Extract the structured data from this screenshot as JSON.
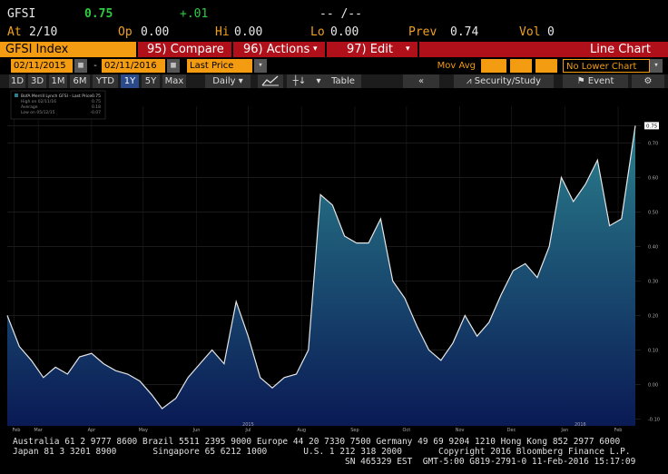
{
  "header": {
    "ticker": "GFSI",
    "last": "0.75",
    "change": "+.01",
    "range_placeholder": "-- /--",
    "at_label": "At",
    "at_value": "2/10",
    "op_label": "Op",
    "op_value": "0.00",
    "hi_label": "Hi",
    "hi_value": "0.00",
    "lo_label": "Lo",
    "lo_value": "0.00",
    "prev_label": "Prev",
    "prev_value": "0.74",
    "vol_label": "Vol",
    "vol_value": "0"
  },
  "command_bar": {
    "security": "GFSI Index",
    "compare": "95) Compare",
    "actions": "96) Actions",
    "edit": "97) Edit",
    "chart_type": "Line Chart"
  },
  "controls": {
    "start_date": "02/11/2015",
    "end_date": "02/11/2016",
    "dash": "-",
    "field": "Last Price",
    "mov_avg_label": "Mov Avg",
    "lower_chart": "No Lower Chart"
  },
  "periods": [
    "1D",
    "3D",
    "1M",
    "6M",
    "YTD",
    "1Y",
    "5Y",
    "Max"
  ],
  "selected_period": "1Y",
  "toolbar": {
    "frequency": "Daily",
    "table": "Table",
    "security_study": "Security/Study",
    "event": "Event"
  },
  "legend": {
    "title": "BofA Merrill Lynch GFSI - Last Price",
    "title_value": "0.75",
    "high_label": "High on 02/11/16",
    "high_value": "0.75",
    "avg_label": "Average",
    "avg_value": "0.18",
    "low_label": "Low on 05/12/15",
    "low_value": "-0.07"
  },
  "colors": {
    "accent_orange": "#f0a020",
    "command_red": "#b0101a",
    "last_green": "#2ecc40",
    "area_top": "#2a7f8c",
    "area_bottom": "#0a1a55"
  },
  "chart_data": {
    "type": "area",
    "x": [
      "2015-02-11",
      "2015-02-18",
      "2015-02-25",
      "2015-03-04",
      "2015-03-11",
      "2015-03-18",
      "2015-03-25",
      "2015-04-01",
      "2015-04-08",
      "2015-04-15",
      "2015-04-22",
      "2015-04-29",
      "2015-05-06",
      "2015-05-12",
      "2015-05-20",
      "2015-05-27",
      "2015-06-03",
      "2015-06-10",
      "2015-06-17",
      "2015-06-24",
      "2015-07-01",
      "2015-07-08",
      "2015-07-15",
      "2015-07-22",
      "2015-07-29",
      "2015-08-05",
      "2015-08-12",
      "2015-08-19",
      "2015-08-26",
      "2015-09-02",
      "2015-09-09",
      "2015-09-16",
      "2015-09-23",
      "2015-09-30",
      "2015-10-07",
      "2015-10-14",
      "2015-10-21",
      "2015-10-28",
      "2015-11-04",
      "2015-11-11",
      "2015-11-18",
      "2015-11-25",
      "2015-12-02",
      "2015-12-09",
      "2015-12-16",
      "2015-12-23",
      "2015-12-30",
      "2016-01-06",
      "2016-01-13",
      "2016-01-20",
      "2016-01-27",
      "2016-02-03",
      "2016-02-11"
    ],
    "values": [
      0.2,
      0.11,
      0.07,
      0.02,
      0.05,
      0.03,
      0.08,
      0.09,
      0.06,
      0.04,
      0.03,
      0.01,
      -0.03,
      -0.07,
      -0.04,
      0.02,
      0.06,
      0.1,
      0.06,
      0.24,
      0.14,
      0.02,
      -0.01,
      0.02,
      0.03,
      0.1,
      0.55,
      0.52,
      0.43,
      0.41,
      0.41,
      0.48,
      0.3,
      0.25,
      0.17,
      0.1,
      0.07,
      0.12,
      0.2,
      0.14,
      0.18,
      0.26,
      0.33,
      0.35,
      0.31,
      0.4,
      0.6,
      0.53,
      0.58,
      0.65,
      0.46,
      0.48,
      0.75
    ],
    "ylim": [
      -0.12,
      0.78
    ],
    "y_ticks": [
      0.75,
      0.7,
      0.6,
      0.5,
      0.4,
      0.3,
      0.2,
      0.1,
      0.0,
      -0.1
    ],
    "x_ticks": [
      "Feb",
      "Mar",
      "Apr",
      "May",
      "Jun",
      "Jul",
      "Aug",
      "Sep",
      "Oct",
      "Nov",
      "Dec",
      "Jan",
      "Feb"
    ],
    "x_year_labels": [
      "2015",
      "2016"
    ],
    "last_value_label": "0.75",
    "grid": true
  },
  "footer": {
    "line1": "Australia 61 2 9777 8600 Brazil 5511 2395 9000 Europe 44 20 7330 7500 Germany 49 69 9204 1210 Hong Kong 852 2977 6000",
    "line2": "Japan 81 3 3201 8900       Singapore 65 6212 1000       U.S. 1 212 318 2000       Copyright 2016 Bloomberg Finance L.P.",
    "line3": "SN 465329 EST  GMT-5:00 G819-2791-0 11-Feb-2016 15:17:09"
  }
}
